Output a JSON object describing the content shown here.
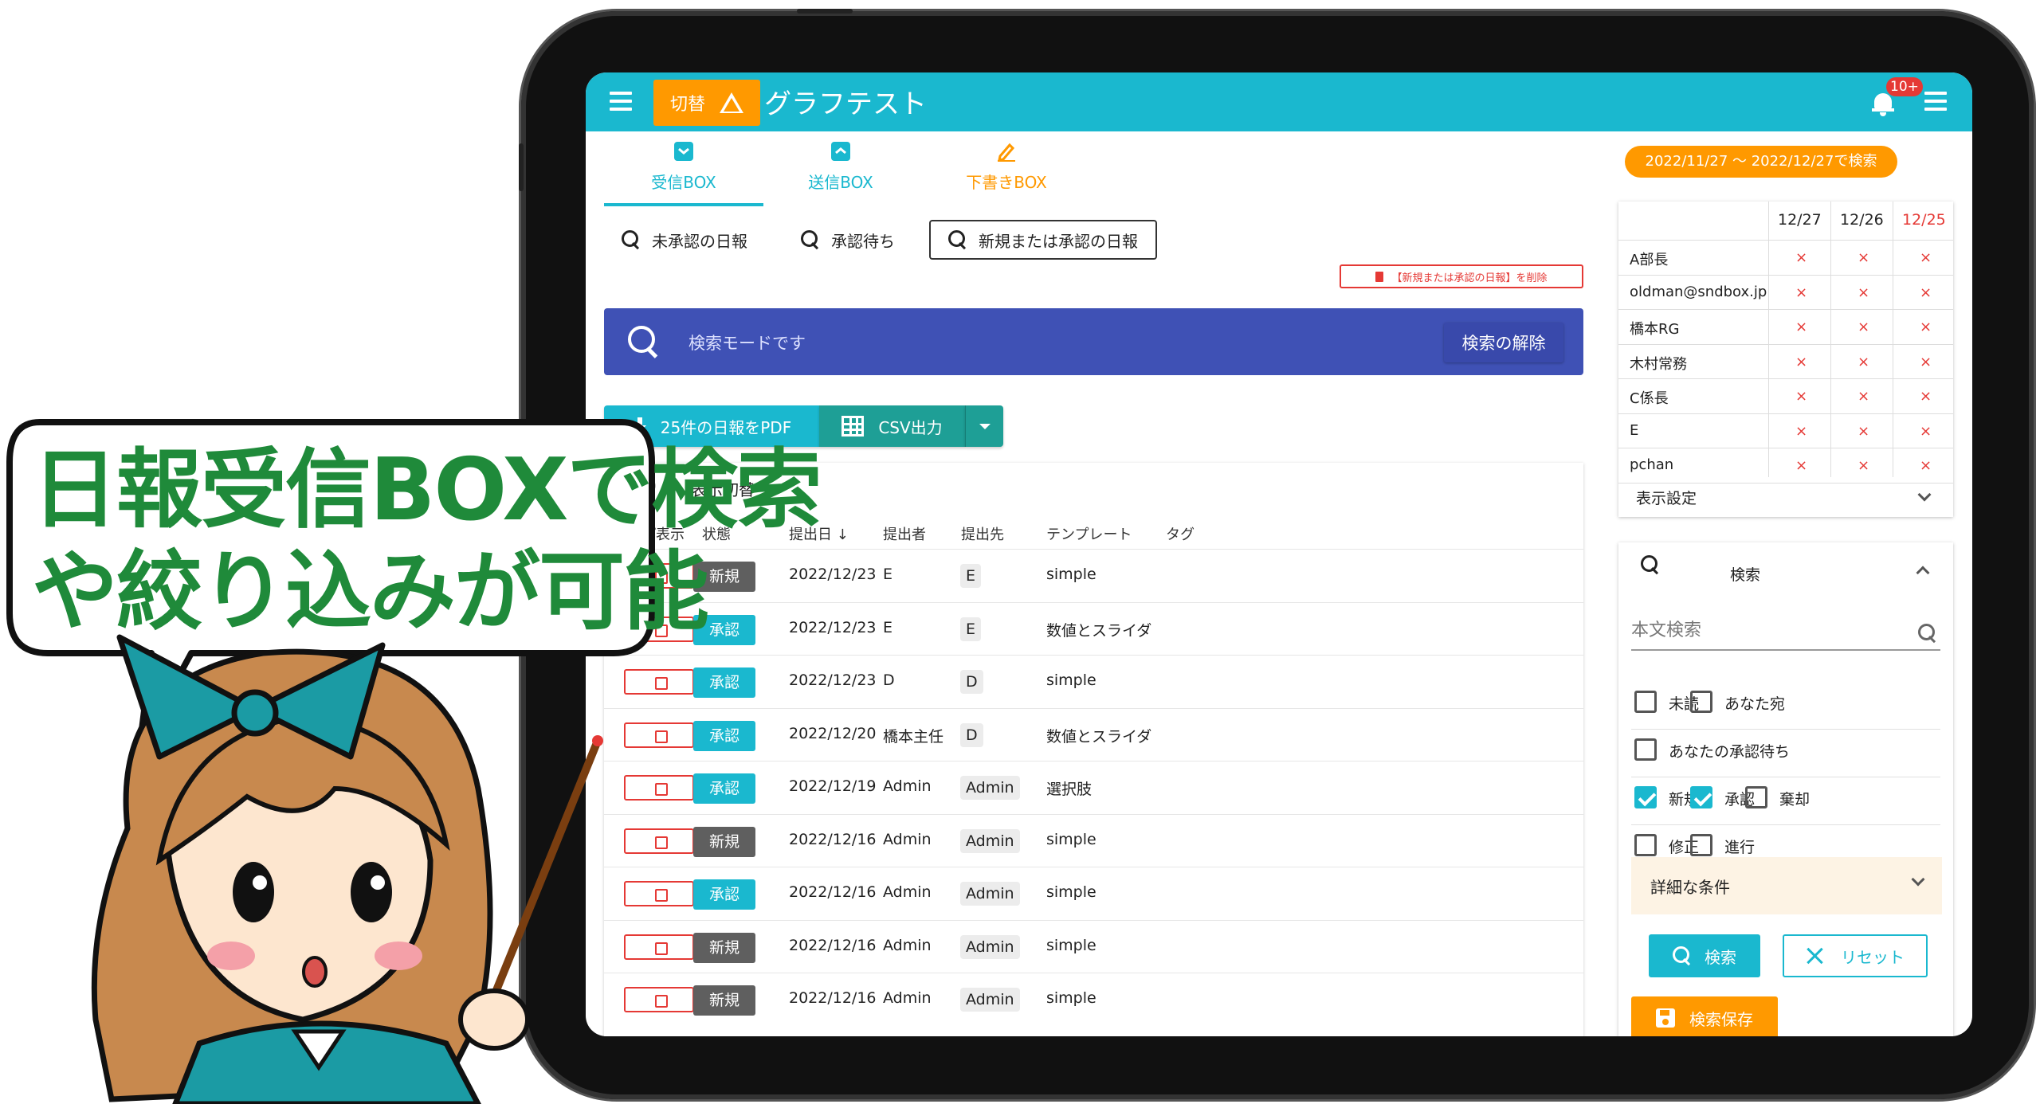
{
  "app": {
    "title": "グラフテスト",
    "switch_label": "切替",
    "badge": "10+"
  },
  "tabs": [
    {
      "label": "受信BOX"
    },
    {
      "label": "送信BOX"
    },
    {
      "label": "下書きBOX"
    }
  ],
  "filters": [
    {
      "label": "未承認の日報"
    },
    {
      "label": "承認待ち"
    },
    {
      "label": "新規または承認の日報"
    }
  ],
  "delete_filter_label": "【新規または承認の日報】を削除",
  "search_banner": {
    "text": "検索モードです",
    "clear_label": "検索の解除"
  },
  "actions": {
    "pdf_label": "25件の日報をPDF",
    "csv_label": "CSV出力"
  },
  "table": {
    "toggle_label": "表示切替",
    "headers": [
      "プ表示",
      "状態",
      "提出日 ↓",
      "提出者",
      "提出先",
      "テンプレート",
      "タグ"
    ],
    "rows": [
      {
        "status": "新規",
        "date": "2022/12/23",
        "submitter": "E",
        "dest": "E",
        "template": "simple"
      },
      {
        "status": "承認",
        "date": "2022/12/23",
        "submitter": "E",
        "dest": "E",
        "template": "数値とスライダ"
      },
      {
        "status": "承認",
        "date": "2022/12/23",
        "submitter": "D",
        "dest": "D",
        "template": "simple"
      },
      {
        "status": "承認",
        "date": "2022/12/20",
        "submitter": "橋本主任",
        "dest": "D",
        "template": "数値とスライダ"
      },
      {
        "status": "承認",
        "date": "2022/12/19",
        "submitter": "Admin",
        "dest": "Admin",
        "template": "選択肢"
      },
      {
        "status": "新規",
        "date": "2022/12/16",
        "submitter": "Admin",
        "dest": "Admin",
        "template": "simple"
      },
      {
        "status": "承認",
        "date": "2022/12/16",
        "submitter": "Admin",
        "dest": "Admin",
        "template": "simple"
      },
      {
        "status": "新規",
        "date": "2022/12/16",
        "submitter": "Admin",
        "dest": "Admin",
        "template": "simple"
      },
      {
        "status": "新規",
        "date": "2022/12/16",
        "submitter": "Admin",
        "dest": "Admin",
        "template": "simple"
      }
    ]
  },
  "date_range": "2022/11/27 〜 2022/12/27で検索",
  "member_table": {
    "dates": [
      "12/27",
      "12/26",
      "12/25"
    ],
    "members": [
      "A部長",
      "oldman@sndbox.jp",
      "橋本RG",
      "木村常務",
      "C係長",
      "E",
      "pchan"
    ],
    "mark": "×",
    "settings_label": "表示設定"
  },
  "search_panel": {
    "title": "検索",
    "placeholder": "本文検索",
    "checkbox_rows": [
      [
        {
          "label": "未読",
          "checked": false
        },
        {
          "label": "あなた宛",
          "checked": false
        }
      ],
      [
        {
          "label": "あなたの承認待ち",
          "checked": false
        }
      ],
      [
        {
          "label": "新規",
          "checked": true
        },
        {
          "label": "承認",
          "checked": true
        },
        {
          "label": "棄却",
          "checked": false
        }
      ],
      [
        {
          "label": "修正",
          "checked": false
        },
        {
          "label": "進行",
          "checked": false
        }
      ]
    ],
    "detail_label": "詳細な条件",
    "search_label": "検索",
    "reset_label": "リセット",
    "save_label": "検索保存"
  },
  "bubble": {
    "line1": "日報受信BOXで検索",
    "line2": "や絞り込みが可能"
  },
  "colors": {
    "primary": "#1ab8cf",
    "accent": "#ff9900",
    "banner": "#3f51b5",
    "status_new": "#5f5f5f",
    "status_approved": "#1ab8cf",
    "danger": "#e53935"
  }
}
